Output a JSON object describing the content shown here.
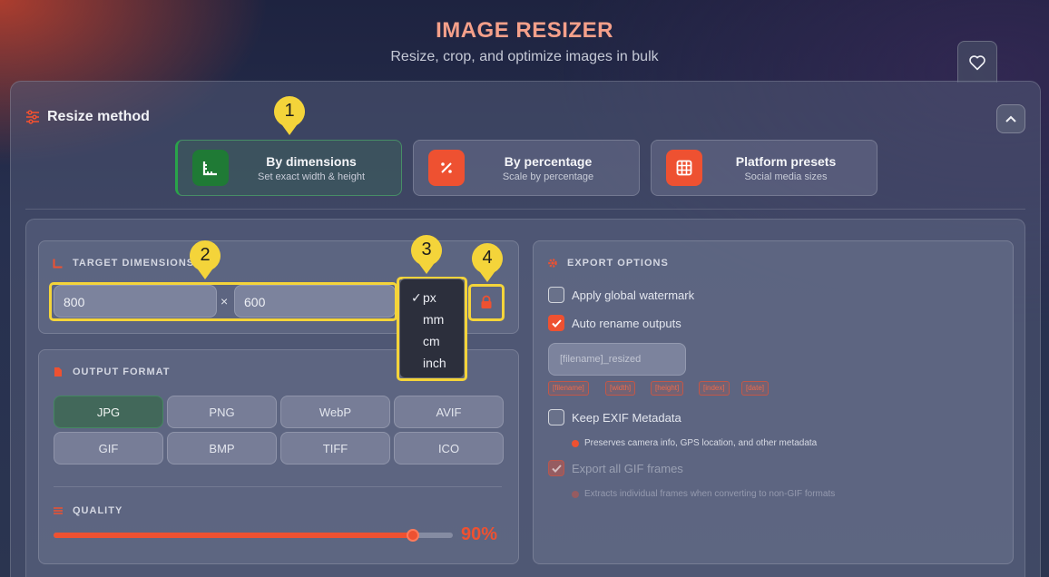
{
  "app": {
    "title": "IMAGE RESIZER",
    "subtitle": "Resize, crop, and optimize images in bulk"
  },
  "resize_method": {
    "label": "Resize method",
    "methods": [
      {
        "title": "By dimensions",
        "sub": "Set exact width & height",
        "active": true,
        "color": "#1f7a35"
      },
      {
        "title": "By percentage",
        "sub": "Scale by percentage",
        "active": false,
        "color": "#ee5131"
      },
      {
        "title": "Platform presets",
        "sub": "Social media sizes",
        "active": false,
        "color": "#ee5131"
      }
    ]
  },
  "target_dimensions": {
    "label": "TARGET DIMENSIONS",
    "width": "800",
    "height": "600",
    "times": "×",
    "units": [
      "px",
      "mm",
      "cm",
      "inch"
    ],
    "selected_unit": "px",
    "check_mark": "✓"
  },
  "output_format": {
    "label": "OUTPUT FORMAT",
    "formats": [
      "JPG",
      "PNG",
      "WebP",
      "AVIF",
      "GIF",
      "BMP",
      "TIFF",
      "ICO"
    ],
    "selected": "JPG"
  },
  "quality": {
    "label": "QUALITY",
    "value": 90,
    "value_text": "90%"
  },
  "export_options": {
    "label": "EXPORT OPTIONS",
    "watermark": {
      "label": "Apply global watermark",
      "checked": false
    },
    "auto_rename": {
      "label": "Auto rename outputs",
      "checked": true
    },
    "rename_placeholder": "[filename]_resized",
    "tokens": [
      "[filename]",
      "[width]",
      "[height]",
      "[index]",
      "[date]"
    ],
    "keep_exif": {
      "label": "Keep EXIF Metadata",
      "checked": false,
      "note": "Preserves camera info, GPS location, and other metadata"
    },
    "gif_frames": {
      "label": "Export all GIF frames",
      "checked": true,
      "disabled": true,
      "note": "Extracts individual frames when converting to non-GIF formats"
    }
  },
  "callouts": [
    "1",
    "2",
    "3",
    "4"
  ],
  "colors": {
    "accent": "#ee5131",
    "callout": "#f4d43a",
    "active_green": "#2aa34a"
  }
}
